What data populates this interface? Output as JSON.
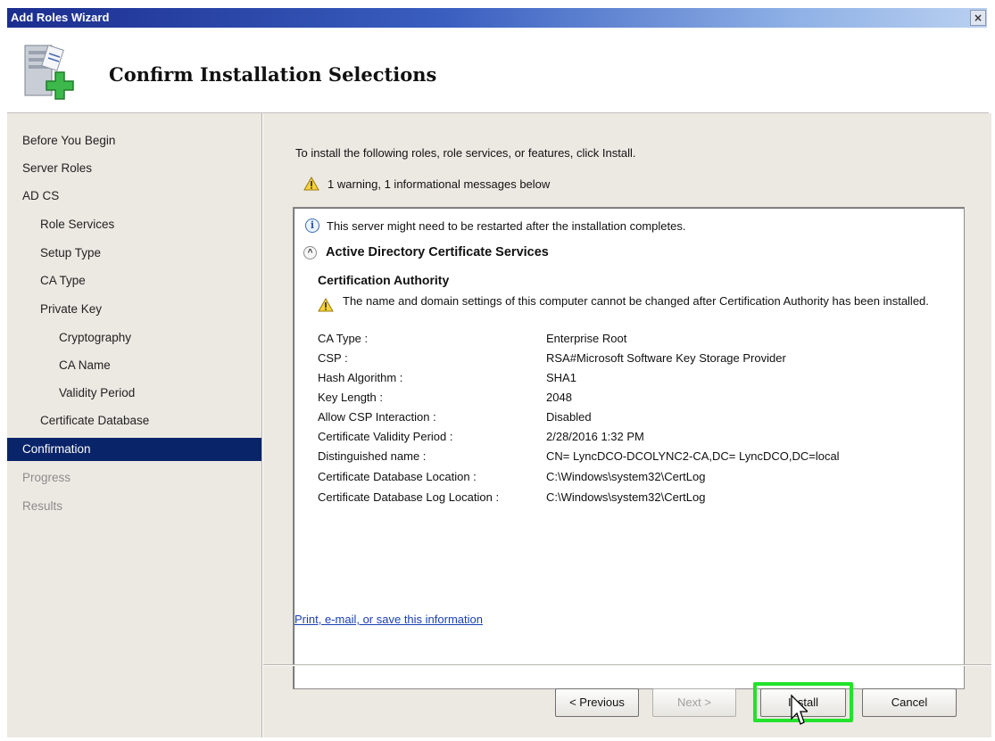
{
  "window": {
    "title": "Add Roles Wizard",
    "close_glyph": "×"
  },
  "header": {
    "heading": "Confirm Installation Selections"
  },
  "nav": {
    "items": [
      {
        "label": "Before You Begin"
      },
      {
        "label": "Server Roles"
      },
      {
        "label": "AD CS"
      },
      {
        "label": "Role Services"
      },
      {
        "label": "Setup Type"
      },
      {
        "label": "CA Type"
      },
      {
        "label": "Private Key"
      },
      {
        "label": "Cryptography"
      },
      {
        "label": "CA Name"
      },
      {
        "label": "Validity Period"
      },
      {
        "label": "Certificate Database"
      },
      {
        "label": "Confirmation"
      },
      {
        "label": "Progress"
      },
      {
        "label": "Results"
      }
    ]
  },
  "content": {
    "intro": "To install the following roles, role services, or features, click Install.",
    "warning_summary": "1 warning, 1 informational messages below",
    "info_message": "This server might need to be restarted after the installation completes.",
    "section_title": "Active Directory Certificate Services",
    "subsection_title": "Certification Authority",
    "warning_message": "The name and domain settings of this computer cannot be changed after Certification Authority has been installed.",
    "details": [
      {
        "key": "CA Type :",
        "value": "Enterprise Root"
      },
      {
        "key": "CSP :",
        "value": "RSA#Microsoft Software Key Storage Provider"
      },
      {
        "key": "Hash Algorithm :",
        "value": "SHA1"
      },
      {
        "key": "Key Length :",
        "value": "2048"
      },
      {
        "key": "Allow CSP Interaction :",
        "value": "Disabled"
      },
      {
        "key": "Certificate Validity Period :",
        "value": "2/28/2016 1:32 PM"
      },
      {
        "key": "Distinguished name :",
        "value": "CN= LyncDCO-DCOLYNC2-CA,DC= LyncDCO,DC=local"
      },
      {
        "key": "Certificate Database Location :",
        "value": "C:\\Windows\\system32\\CertLog"
      },
      {
        "key": "Certificate Database Log Location :",
        "value": "C:\\Windows\\system32\\CertLog"
      }
    ],
    "print_link": "Print, e-mail, or save this information"
  },
  "buttons": {
    "previous": "< Previous",
    "next": "Next >",
    "install": "Install",
    "cancel": "Cancel"
  },
  "colors": {
    "selected_nav": "#0a246a",
    "install_highlight": "#22e22a",
    "link": "#1a3fb3"
  }
}
